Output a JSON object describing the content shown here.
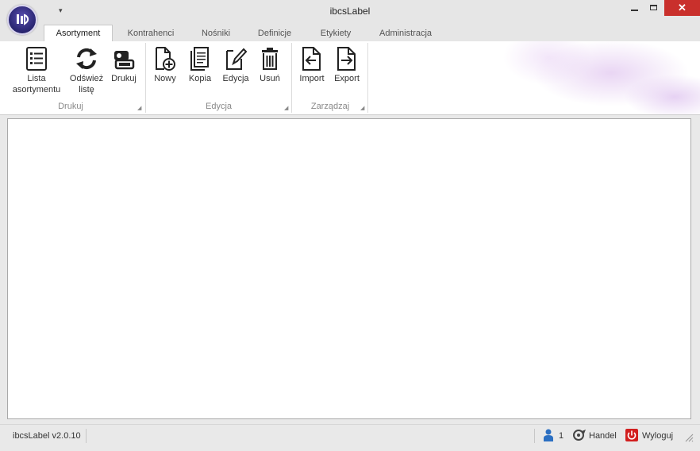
{
  "window": {
    "title": "ibcsLabel",
    "close_glyph": "✕"
  },
  "qat": {
    "glyph": "▾"
  },
  "tabs": [
    {
      "label": "Asortyment",
      "active": true
    },
    {
      "label": "Kontrahenci",
      "active": false
    },
    {
      "label": "Nośniki",
      "active": false
    },
    {
      "label": "Definicje",
      "active": false
    },
    {
      "label": "Etykiety",
      "active": false
    },
    {
      "label": "Administracja",
      "active": false
    }
  ],
  "ribbon": {
    "groups": [
      {
        "label": "Drukuj"
      },
      {
        "label": "Edycja"
      },
      {
        "label": "Zarządzaj"
      }
    ],
    "buttons": {
      "lista_line1": "Lista",
      "lista_line2": "asortymentu",
      "odswiez_line1": "Odśwież",
      "odswiez_line2": "listę",
      "drukuj": "Drukuj",
      "nowy": "Nowy",
      "kopia": "Kopia",
      "edycja": "Edycja",
      "usun": "Usuń",
      "import": "Import",
      "export": "Export"
    },
    "launcher_glyph": "◢"
  },
  "status": {
    "version": "ibcsLabel v2.0.10",
    "user_count": "1",
    "department": "Handel",
    "logout": "Wyloguj"
  },
  "colors": {
    "accent_close": "#c9302c",
    "user_icon": "#2b6fc2",
    "logout_icon": "#d21f1f"
  }
}
